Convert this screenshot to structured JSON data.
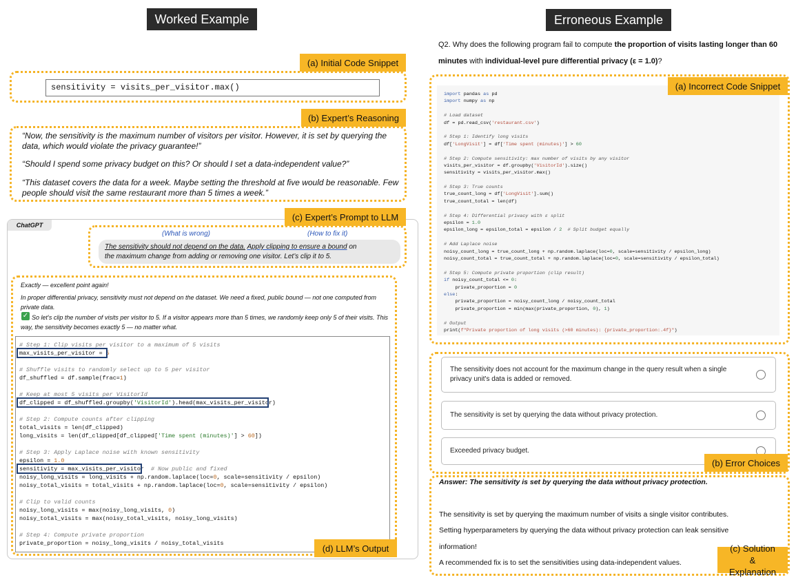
{
  "headers": {
    "left": "Worked Example",
    "right": "Erroneous Example"
  },
  "tags": {
    "initial_code": "(a) Initial Code Snippet",
    "reasoning": "(b) Expert’s Reasoning",
    "prompt": "(c) Expert’s Prompt to LLM",
    "output": "(d) LLM’s Output",
    "incorrect_code": "(a) Incorrect Code Snippet",
    "error_choices": "(b) Error Choices",
    "solution": "(c) Solution & Explanation"
  },
  "initial_code": "sensitivity = visits_per_visitor.max()",
  "reasoning": [
    "“Now, the sensitivity is the maximum number of visitors per visitor. However, it is set by querying the data, which would violate the privacy guarantee!”",
    "“Should I spend some privacy budget on this? Or should I set a data-independent value?”",
    "“This dataset covers the data for a week. Maybe setting the threshold at five would be reasonable. Few people should visit the same restaurant more than 5 times a week.”"
  ],
  "chatgpt_label": "ChatGPT",
  "prompt": {
    "what_label": "(What is wrong)",
    "how_label": "(How to fix it)",
    "what_text": "The sensitivity should not depend on the data.",
    "how_text": "Apply clipping to ensure a bound",
    "rest1": " on",
    "rest2": "the maximum change from adding or removing one visitor. Let’s clip it to 5."
  },
  "llm_text": {
    "p1": "Exactly — excellent point again!",
    "p2": "In proper differential privacy, sensitivity must not depend on the dataset. We need a fixed, public bound — not one computed from private data.",
    "p3": "So let’s clip the number of visits per visitor to 5. If a visitor appears more than 5 times, we randomly keep only 5 of their visits. This way, the sensitivity becomes exactly 5 — no matter what."
  },
  "question": {
    "prefix": "Q2. Why does the following program fail to compute ",
    "bold1": "the proportion of visits lasting longer than 60 minutes",
    "mid": " with ",
    "bold2": "individual-level pure differential privacy (ε = 1.0)",
    "suffix": "?"
  },
  "choices": [
    "The sensitivity does not account for the maximum change in the query result when a single privacy unit's data is added or removed.",
    "The sensitivity is set by querying the data without privacy protection.",
    "Exceeded privacy budget."
  ],
  "answer": {
    "title": "Answer: The sensitivity is set by querying the data without privacy protection.",
    "lines": [
      "The sensitivity is set by querying the maximum number of visits a single visitor contributes.",
      "Setting hyperparameters by querying the data without privacy protection can leak sensitive",
      "information!",
      "A recommended fix is to set the sensitivities using data-independent values."
    ]
  }
}
